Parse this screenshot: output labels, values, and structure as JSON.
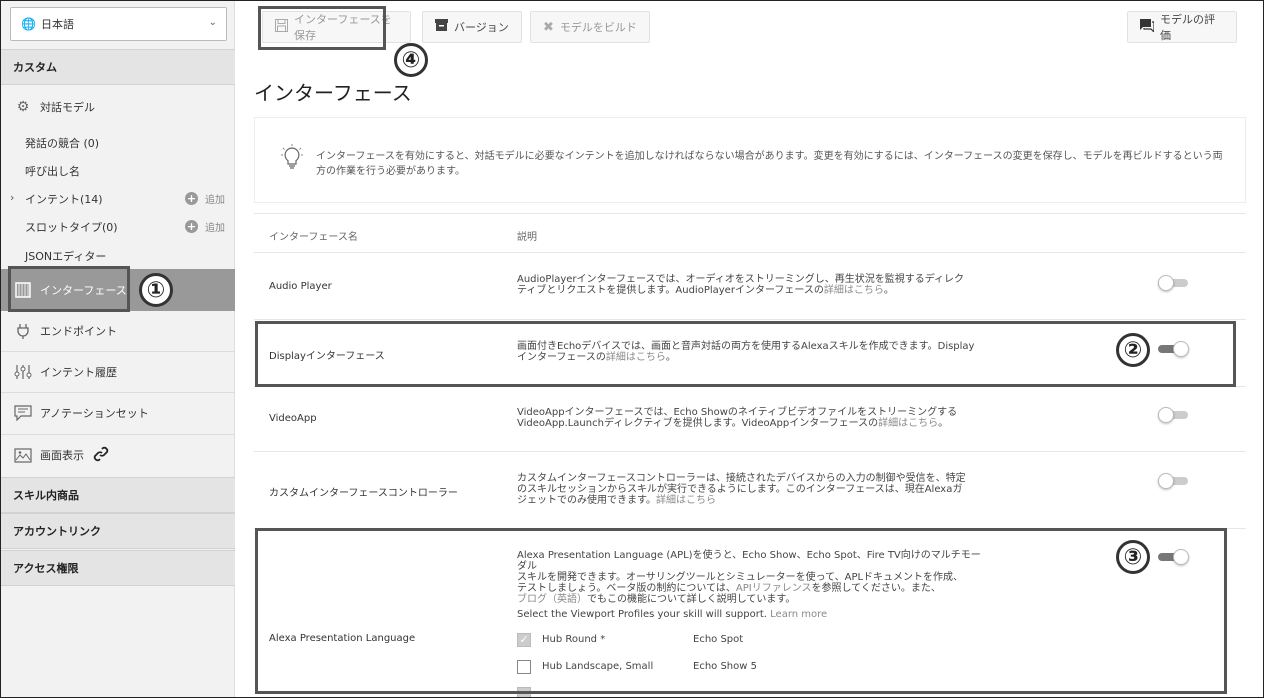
{
  "sidebar": {
    "language": "日本語",
    "section_custom": "カスタム",
    "interaction_model": "対話モデル",
    "sub_items": {
      "utterance_conflicts": "発話の競合 (0)",
      "invocation_name": "呼び出し名",
      "intents": "インテント(14)",
      "slot_types": "スロットタイプ(0)",
      "json_editor": "JSONエディター"
    },
    "add_label": "追加",
    "interfaces": "インターフェース",
    "endpoint": "エンドポイント",
    "intent_history": "インテント履歴",
    "annotation_sets": "アノテーションセット",
    "display": "画面表示",
    "section_isp": "スキル内商品",
    "section_account_linking": "アカウントリンク",
    "section_permissions": "アクセス権限"
  },
  "toolbar": {
    "save": "インターフェースを保存",
    "version": "バージョン",
    "build": "モデルをビルド",
    "evaluate": "モデルの評価"
  },
  "page_title": "インターフェース",
  "info_text": "インターフェースを有効にすると、対話モデルに必要なインテントを追加しなければならない場合があります。変更を有効にするには、インターフェースの変更を保存し、モデルを再ビルドするという両方の作業を行う必要があります。",
  "table": {
    "col_name": "インターフェース名",
    "col_desc": "説明"
  },
  "interfaces": {
    "audio": {
      "name": "Audio Player",
      "desc1": "AudioPlayerインターフェースでは、オーディオをストリーミングし、再生状況を監視するディレク",
      "desc2": "ティブとリクエストを提供します。AudioPlayerインターフェースの",
      "link": "詳細はこちら",
      "tail": "。"
    },
    "display": {
      "name": "Displayインターフェース",
      "desc1": "画面付きEchoデバイスでは、画面と音声対話の両方を使用するAlexaスキルを作成できます。Display",
      "desc2": "インターフェースの",
      "link": "詳細はこちら",
      "tail": "。"
    },
    "video": {
      "name": "VideoApp",
      "desc1": "VideoAppインターフェースでは、Echo Showのネイティブビデオファイルをストリーミングする",
      "desc2": "VideoApp.Launchディレクティブを提供します。VideoAppインターフェースの",
      "link": "詳細はこちら",
      "tail": "。"
    },
    "custom": {
      "name": "カスタムインターフェースコントローラー",
      "desc1": "カスタムインターフェースコントローラーは、接続されたデバイスからの入力の制御や受信を、特定",
      "desc2": "のスキルセッションからスキルが実行できるようにします。このインターフェースは、現在Alexaガ",
      "desc3": "ジェットでのみ使用できます。",
      "link": "詳細はこちら"
    },
    "apl": {
      "name": "Alexa Presentation Language",
      "desc1": "Alexa Presentation Language (APL)を使うと、Echo Show、Echo Spot、Fire TV向けのマルチモーダル",
      "desc2": "スキルを開発できます。オーサリングツールとシミュレーターを使って、APLドキュメントを作成、",
      "desc3a": "テストしましょう。ベータ版の制約については、",
      "desc3_link": "APIリファレンス",
      "desc3b": "を参照してください。また、",
      "desc4_link": "ブログ（英語）",
      "desc4b": "でもこの機能について詳しく説明しています。",
      "viewport_prompt": "Select the Viewport Profiles your skill will support.",
      "learn_more": "Learn more",
      "viewports": [
        {
          "profile": "Hub Round *",
          "device": "Echo Spot"
        },
        {
          "profile": "Hub Landscape, Small",
          "device": "Echo Show 5"
        }
      ]
    }
  },
  "markers": [
    "①",
    "②",
    "③",
    "④"
  ]
}
